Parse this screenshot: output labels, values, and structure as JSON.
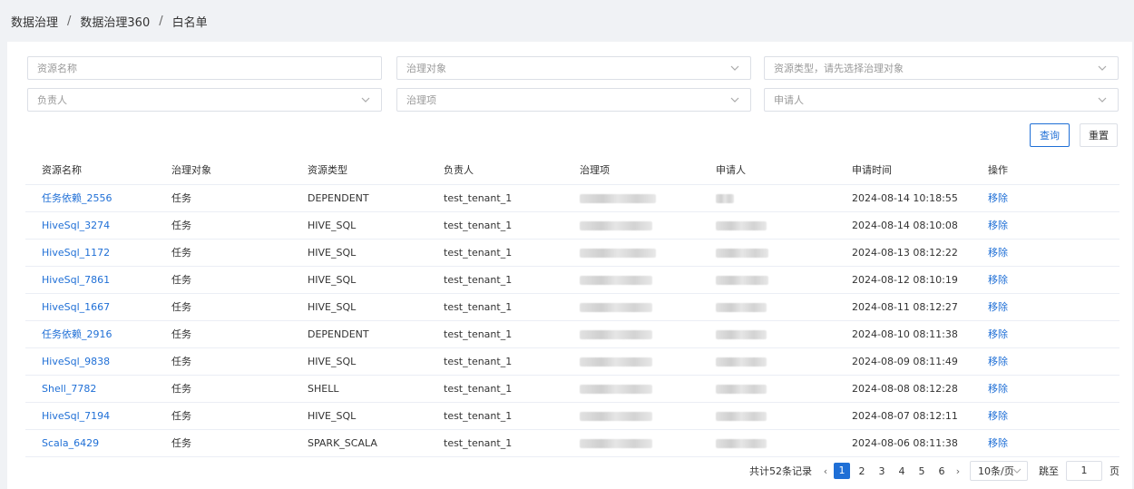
{
  "breadcrumb": {
    "level1": "数据治理",
    "level2": "数据治理360",
    "level3": "白名单",
    "sep": "/"
  },
  "filters": {
    "resource_name": {
      "placeholder": "资源名称"
    },
    "gov_object": {
      "placeholder": "治理对象"
    },
    "resource_type": {
      "placeholder": "资源类型，请先选择治理对象"
    },
    "owner": {
      "placeholder": "负责人"
    },
    "gov_item": {
      "placeholder": "治理项"
    },
    "applicant": {
      "placeholder": "申请人"
    }
  },
  "buttons": {
    "query": "查询",
    "reset": "重置"
  },
  "table": {
    "headers": [
      "资源名称",
      "治理对象",
      "资源类型",
      "负责人",
      "治理项",
      "申请人",
      "申请时间",
      "操作"
    ],
    "rows": [
      {
        "name": "任务依赖_2556",
        "object": "任务",
        "type": "DEPENDENT",
        "owner": "test_tenant_1",
        "time": "2024-08-14 10:18:55",
        "op": "移除"
      },
      {
        "name": "HiveSql_3274",
        "object": "任务",
        "type": "HIVE_SQL",
        "owner": "test_tenant_1",
        "time": "2024-08-14 08:10:08",
        "op": "移除"
      },
      {
        "name": "HiveSql_1172",
        "object": "任务",
        "type": "HIVE_SQL",
        "owner": "test_tenant_1",
        "time": "2024-08-13 08:12:22",
        "op": "移除"
      },
      {
        "name": "HiveSql_7861",
        "object": "任务",
        "type": "HIVE_SQL",
        "owner": "test_tenant_1",
        "time": "2024-08-12 08:10:19",
        "op": "移除"
      },
      {
        "name": "HiveSql_1667",
        "object": "任务",
        "type": "HIVE_SQL",
        "owner": "test_tenant_1",
        "time": "2024-08-11 08:12:27",
        "op": "移除"
      },
      {
        "name": "任务依赖_2916",
        "object": "任务",
        "type": "DEPENDENT",
        "owner": "test_tenant_1",
        "time": "2024-08-10 08:11:38",
        "op": "移除"
      },
      {
        "name": "HiveSql_9838",
        "object": "任务",
        "type": "HIVE_SQL",
        "owner": "test_tenant_1",
        "time": "2024-08-09 08:11:49",
        "op": "移除"
      },
      {
        "name": "Shell_7782",
        "object": "任务",
        "type": "SHELL",
        "owner": "test_tenant_1",
        "time": "2024-08-08 08:12:28",
        "op": "移除"
      },
      {
        "name": "HiveSql_7194",
        "object": "任务",
        "type": "HIVE_SQL",
        "owner": "test_tenant_1",
        "time": "2024-08-07 08:12:11",
        "op": "移除"
      },
      {
        "name": "Scala_6429",
        "object": "任务",
        "type": "SPARK_SCALA",
        "owner": "test_tenant_1",
        "time": "2024-08-06 08:11:38",
        "op": "移除"
      }
    ]
  },
  "pagination": {
    "total_text": "共计52条记录",
    "pages": [
      "1",
      "2",
      "3",
      "4",
      "5",
      "6"
    ],
    "current": "1",
    "prev": "‹",
    "next": "›",
    "page_size": "10条/页",
    "jump_label": "跳至",
    "jump_value": "1",
    "page_suffix": "页"
  },
  "colors": {
    "accent": "#1f6fd6",
    "border": "#dcdfe6",
    "background": "#f0f2f5"
  }
}
